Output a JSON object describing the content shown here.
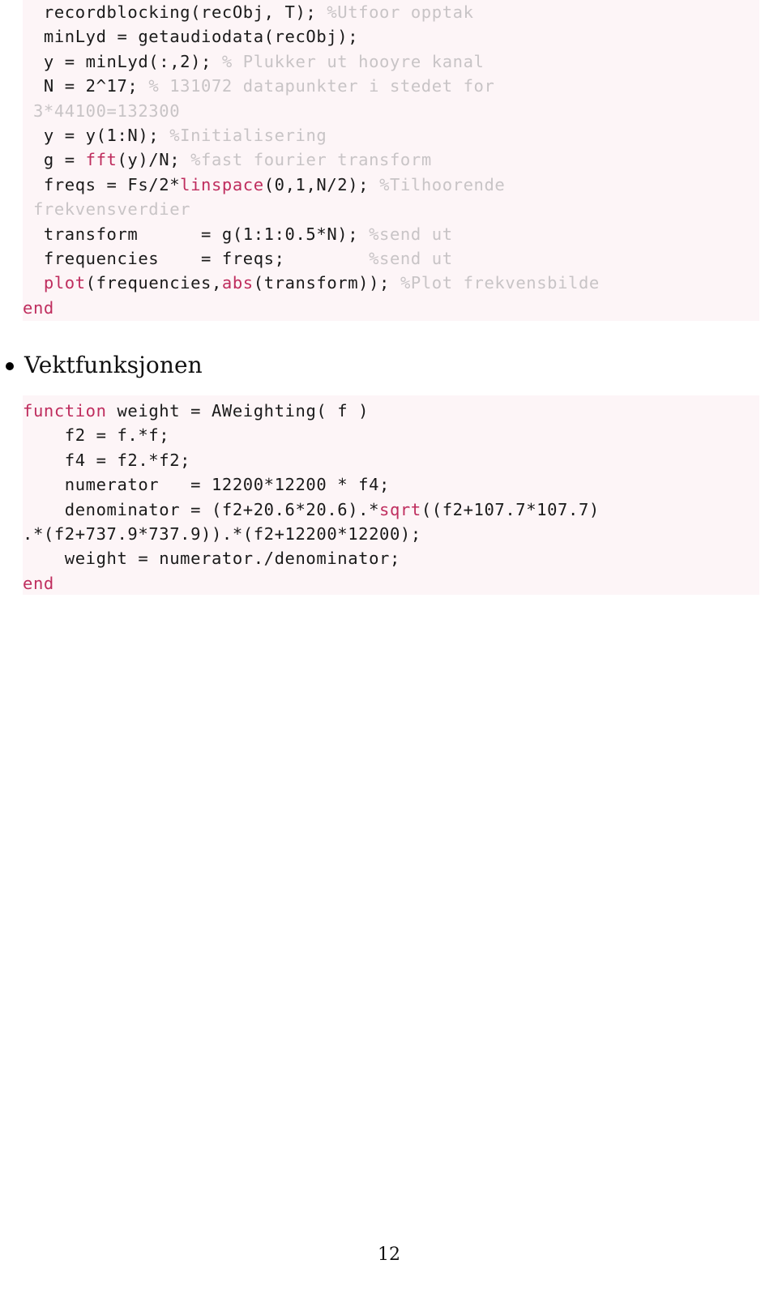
{
  "page": {
    "number": "12",
    "background": "#ffffff"
  },
  "colors": {
    "code_background": "#fdf5f7",
    "keyword": "#bf2d5e",
    "comment": "#c8c4c6",
    "text": "#1a1a1a"
  },
  "code_block_1": {
    "lines": [
      [
        {
          "t": "  recordblocking(recObj, T); ",
          "c": "plain"
        },
        {
          "t": "%Utfoor opptak",
          "c": "cmt"
        }
      ],
      [
        {
          "t": "  minLyd = getaudiodata(recObj);",
          "c": "plain"
        }
      ],
      [
        {
          "t": "  y = minLyd(:,2); ",
          "c": "plain"
        },
        {
          "t": "% Plukker ut hooyre kanal",
          "c": "cmt"
        }
      ],
      [
        {
          "t": "  N = 2^17; ",
          "c": "plain"
        },
        {
          "t": "% 131072 datapunkter i stedet for",
          "c": "cmt"
        }
      ],
      [
        {
          "t": " 3*44100=132300",
          "c": "cmt"
        }
      ],
      [
        {
          "t": "  y = y(1:N); ",
          "c": "plain"
        },
        {
          "t": "%Initialisering",
          "c": "cmt"
        }
      ],
      [
        {
          "t": "  g = ",
          "c": "plain"
        },
        {
          "t": "fft",
          "c": "kw"
        },
        {
          "t": "(y)/N; ",
          "c": "plain"
        },
        {
          "t": "%fast fourier transform",
          "c": "cmt"
        }
      ],
      [
        {
          "t": "  freqs = Fs/2*",
          "c": "plain"
        },
        {
          "t": "linspace",
          "c": "kw"
        },
        {
          "t": "(0,1,N/2); ",
          "c": "plain"
        },
        {
          "t": "%Tilhoorende",
          "c": "cmt"
        }
      ],
      [
        {
          "t": " frekvensverdier",
          "c": "cmt"
        }
      ],
      [
        {
          "t": "  transform      = g(1:1:0.5*N); ",
          "c": "plain"
        },
        {
          "t": "%send ut",
          "c": "cmt"
        }
      ],
      [
        {
          "t": "  frequencies    = freqs;        ",
          "c": "plain"
        },
        {
          "t": "%send ut",
          "c": "cmt"
        }
      ],
      [
        {
          "t": "  ",
          "c": "plain"
        },
        {
          "t": "plot",
          "c": "kw"
        },
        {
          "t": "(frequencies,",
          "c": "plain"
        },
        {
          "t": "abs",
          "c": "kw"
        },
        {
          "t": "(transform)); ",
          "c": "plain"
        },
        {
          "t": "%Plot frekvensbilde",
          "c": "cmt"
        }
      ],
      [
        {
          "t": "end",
          "c": "kw"
        }
      ]
    ]
  },
  "bullet": {
    "marker": "bullet-dot",
    "label": "Vektfunksjonen"
  },
  "code_block_2": {
    "lines": [
      [
        {
          "t": "function",
          "c": "kw"
        },
        {
          "t": " weight = AWeighting( f )",
          "c": "plain"
        }
      ],
      [
        {
          "t": "    f2 = f.*f;",
          "c": "plain"
        }
      ],
      [
        {
          "t": "    f4 = f2.*f2;",
          "c": "plain"
        }
      ],
      [
        {
          "t": "    numerator   = 12200*12200 * f4;",
          "c": "plain"
        }
      ],
      [
        {
          "t": "    denominator = (f2+20.6*20.6).*",
          "c": "plain"
        },
        {
          "t": "sqrt",
          "c": "kw"
        },
        {
          "t": "((f2+107.7*107.7)",
          "c": "plain"
        }
      ],
      [
        {
          "t": ".*(f2+737.9*737.9)).*(f2+12200*12200);",
          "c": "plain"
        }
      ],
      [
        {
          "t": "    weight = numerator./denominator;",
          "c": "plain"
        }
      ],
      [
        {
          "t": "end",
          "c": "kw"
        }
      ]
    ]
  }
}
